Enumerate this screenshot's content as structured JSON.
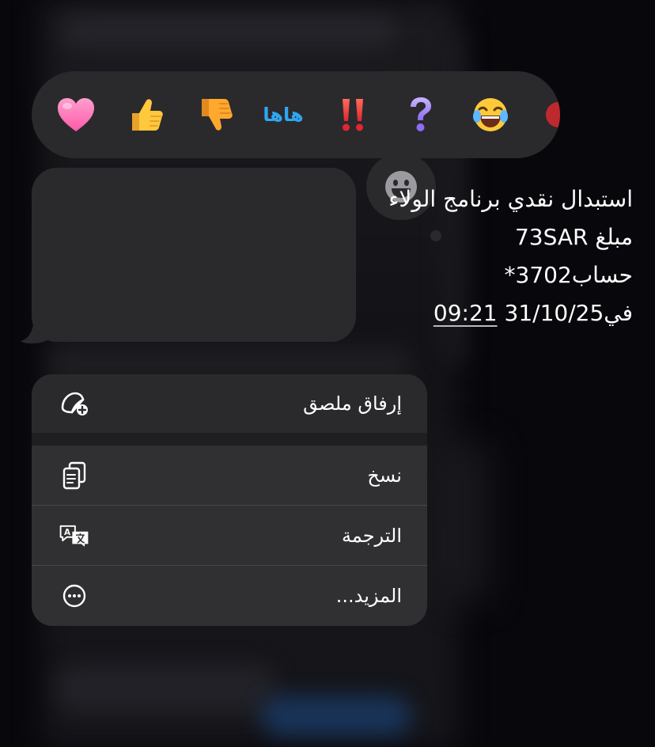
{
  "reactions": {
    "items": [
      {
        "name": "heart",
        "glyph": "❤"
      },
      {
        "name": "thumbs-up",
        "glyph": "👍"
      },
      {
        "name": "thumbs-down",
        "glyph": "👎"
      },
      {
        "name": "haha",
        "label": "ها‌ها"
      },
      {
        "name": "exclamation",
        "glyph": "‼"
      },
      {
        "name": "question",
        "glyph": "?"
      },
      {
        "name": "laughing",
        "glyph": "😂"
      }
    ]
  },
  "message": {
    "line1": "استبدال نقدي برنامج الولاء",
    "line2": "مبلغ 73SAR",
    "line3": "حساب3702*",
    "line4_prefix": "في",
    "date": "31/10/25",
    "time": "09:21"
  },
  "menu": {
    "sticker_label": "إرفاق ملصق",
    "copy_label": "نسخ",
    "translate_label": "الترجمة",
    "more_label": "المزيد..."
  },
  "colors": {
    "bubble": "#2a2a2d",
    "menu": "#303033",
    "haha_blue": "#2fa6f0",
    "background": "#07070c"
  }
}
